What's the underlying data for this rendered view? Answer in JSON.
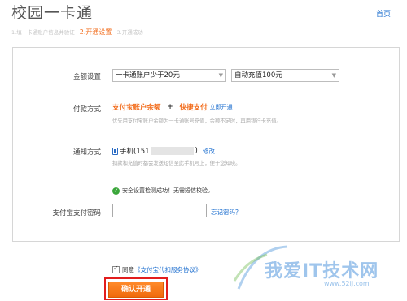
{
  "header": {
    "title": "校园一卡通",
    "home_link": "首页"
  },
  "steps": [
    {
      "label": "1.填一卡通账户信息并验证",
      "state": "done"
    },
    {
      "label": "2.开通设置",
      "state": "active"
    },
    {
      "label": "3.开通成功",
      "state": "pending"
    }
  ],
  "amount": {
    "label": "金额设置",
    "threshold_select": "一卡通账户少于20元",
    "recharge_select": "自动充值100元"
  },
  "payment": {
    "label": "付款方式",
    "option1": "支付宝账户余额",
    "plus": "+",
    "option2": "快捷支付",
    "open_link": "立即开通",
    "hint": "优先用支付宝账户余额为一卡通账号充值，余额不足时，再用银行卡充值。"
  },
  "notify": {
    "label": "通知方式",
    "phone_prefix": "手机(151",
    "phone_suffix": ")",
    "edit_link": "修改",
    "hint": "扣款和充值时都会发送短信至此手机号上，便于您知晓。"
  },
  "security": {
    "message": "安全设置检测成功！无需短信校验。"
  },
  "password": {
    "label": "支付宝支付密码",
    "value": "",
    "forgot_link": "忘记密码？"
  },
  "agreement": {
    "checked": true,
    "prefix": "同意",
    "protocol": "《支付宝代扣服务协议》"
  },
  "confirm_button": "确认开通",
  "watermark": {
    "text": "我爱IT技术网",
    "url": "www.52ij.com"
  },
  "colors": {
    "accent_orange": "#f26b1a",
    "link_blue": "#1e6fcf",
    "highlight_red": "#e21d1d",
    "success_green": "#3aa63a"
  }
}
